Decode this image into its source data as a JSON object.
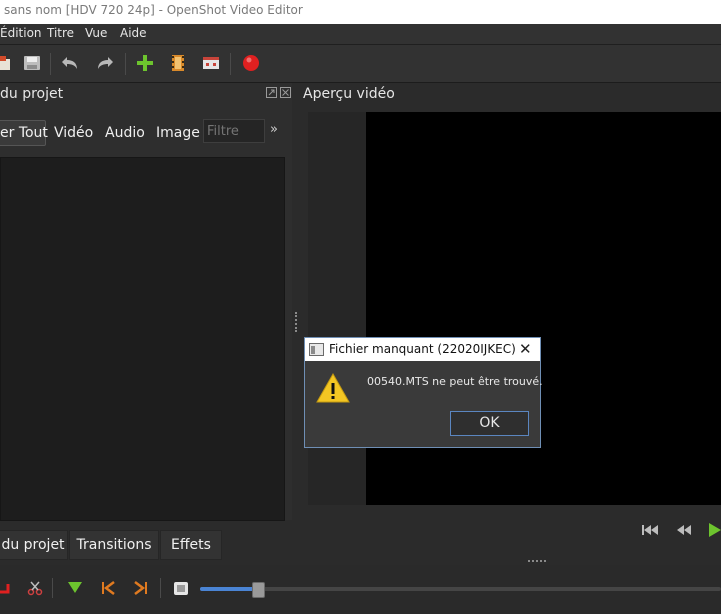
{
  "window": {
    "title": "sans nom [HDV 720 24p] - OpenShot Video Editor"
  },
  "menu": {
    "items": [
      "Édition",
      "Titre",
      "Vue",
      "Aide"
    ]
  },
  "toolbar": {
    "icons": [
      "import-files-icon",
      "save-icon",
      "undo-icon",
      "redo-icon",
      "add-track-icon",
      "film-icon",
      "fullscreen-icon",
      "record-icon"
    ]
  },
  "project_files": {
    "title": "du projet",
    "tabs": [
      "er Tout",
      "Vidéo",
      "Audio",
      "Image"
    ],
    "filter_placeholder": "Filtre",
    "more": "»"
  },
  "preview": {
    "title": "Aperçu vidéo"
  },
  "bottom_tabs": [
    "du projet",
    "Transitions",
    "Effets"
  ],
  "dialog": {
    "title": "Fichier manquant (22020IJKEC)",
    "message": "00540.MTS ne peut être trouvé.",
    "ok": "OK",
    "close": "✕"
  },
  "colors": {
    "accent": "#5b86c0",
    "warning": "#f3c623",
    "record": "#e02020"
  }
}
